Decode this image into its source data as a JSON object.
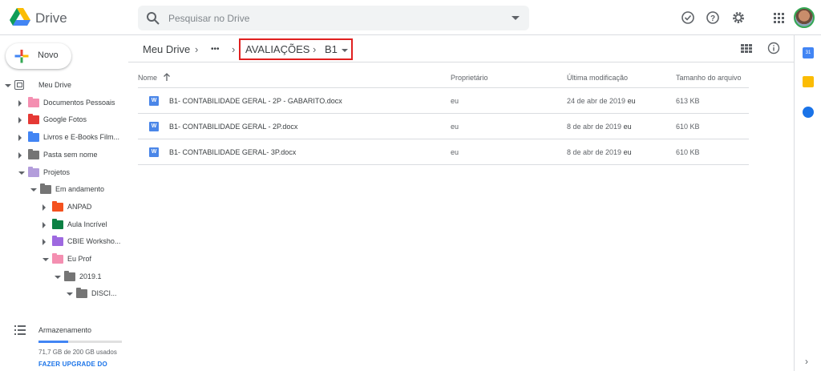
{
  "header": {
    "app_name": "Drive",
    "search_placeholder": "Pesquisar no Drive"
  },
  "sidebar": {
    "new_label": "Novo",
    "tree": [
      {
        "label": "Meu Drive",
        "expanded": true,
        "level": 0,
        "icon": "drive-icon"
      },
      {
        "label": "Documentos Pessoais",
        "expanded": false,
        "level": 1,
        "color": "#f48fb1"
      },
      {
        "label": "Google Fotos",
        "expanded": false,
        "level": 1,
        "color": "#e53935"
      },
      {
        "label": "Livros e E-Books Film...",
        "expanded": false,
        "level": 1,
        "color": "#4285f4"
      },
      {
        "label": "Pasta sem nome",
        "expanded": false,
        "level": 1,
        "color": "#757575"
      },
      {
        "label": "Projetos",
        "expanded": true,
        "level": 1,
        "color": "#b39ddb"
      },
      {
        "label": "Em andamento",
        "expanded": true,
        "level": 2,
        "color": "#757575"
      },
      {
        "label": "ANPAD",
        "expanded": false,
        "level": 3,
        "color": "#f4511e"
      },
      {
        "label": "Aula Incrível",
        "expanded": false,
        "level": 3,
        "color": "#0b8043"
      },
      {
        "label": "CBIE Worksho...",
        "expanded": false,
        "level": 3,
        "color": "#9e69e0"
      },
      {
        "label": "Eu Prof",
        "expanded": true,
        "level": 3,
        "color": "#f48fb1"
      },
      {
        "label": "2019.1",
        "expanded": true,
        "level": 4,
        "color": "#757575"
      },
      {
        "label": "DISCI...",
        "expanded": true,
        "level": 5,
        "color": "#757575"
      }
    ],
    "storage": {
      "title": "Armazenamento",
      "usage_text": "71,7 GB de 200 GB usados",
      "used_fraction": 0.36,
      "upgrade_label": "FAZER UPGRADE DO"
    }
  },
  "breadcrumb": {
    "root": "Meu Drive",
    "ellipsis": "•••",
    "folder": "AVALIAÇÕES",
    "current": "B1"
  },
  "table": {
    "columns": [
      "Nome",
      "Proprietário",
      "Última modificação",
      "Tamanho do arquivo"
    ],
    "rows": [
      {
        "name": "B1- CONTABILIDADE GERAL - 2P - GABARITO.docx",
        "owner": "eu",
        "modified": "24 de abr de 2019",
        "modified_by": "eu",
        "size": "613 KB"
      },
      {
        "name": "B1- CONTABILIDADE GERAL - 2P.docx",
        "owner": "eu",
        "modified": "8 de abr de 2019",
        "modified_by": "eu",
        "size": "610 KB"
      },
      {
        "name": "B1- CONTABILIDADE GERAL- 3P.docx",
        "owner": "eu",
        "modified": "8 de abr de 2019",
        "modified_by": "eu",
        "size": "610 KB"
      }
    ]
  },
  "icons": {
    "file_type_letter": "W"
  },
  "colors": {
    "accent": "#1a73e8",
    "highlight_box": "#e02020"
  }
}
